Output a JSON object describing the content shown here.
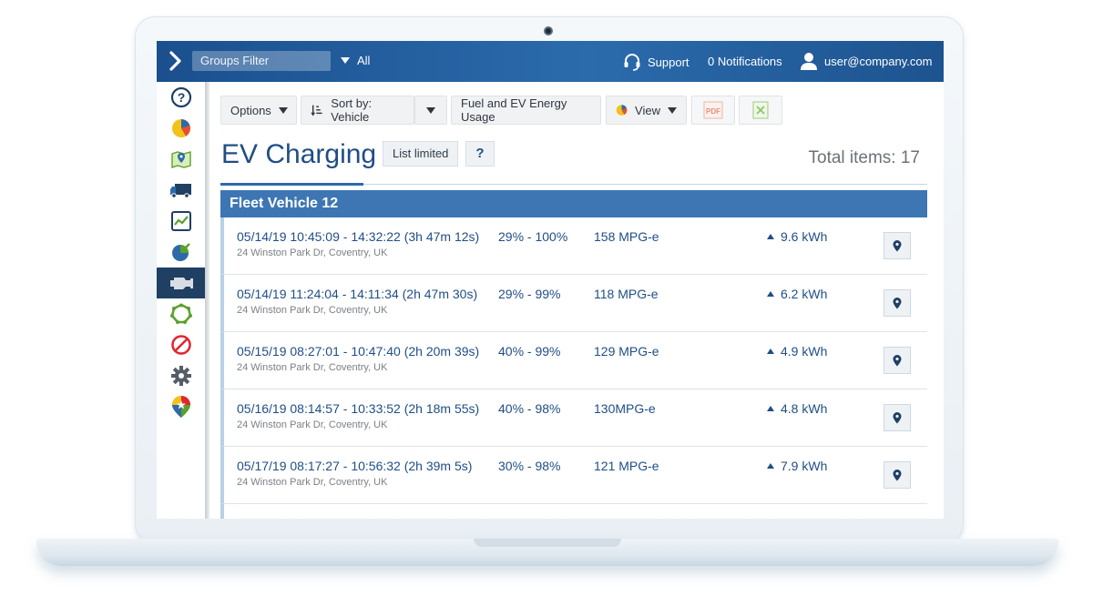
{
  "topbar": {
    "groups_filter_label": "Groups Filter",
    "filter_value": "All",
    "support_label": "Support",
    "notifications_label": "0 Notifications",
    "user_email": "user@company.com"
  },
  "sidebar": {
    "items": [
      {
        "icon": "help-icon"
      },
      {
        "icon": "pie-chart-icon"
      },
      {
        "icon": "map-icon"
      },
      {
        "icon": "truck-icon"
      },
      {
        "icon": "activity-chart-icon"
      },
      {
        "icon": "rules-icon"
      },
      {
        "icon": "engine-icon",
        "active": true
      },
      {
        "icon": "zones-icon"
      },
      {
        "icon": "exceptions-icon"
      },
      {
        "icon": "settings-gear-icon"
      },
      {
        "icon": "marketplace-icon"
      }
    ]
  },
  "toolbar": {
    "options_label": "Options",
    "sort_label": "Sort by: Vehicle",
    "report_label": "Fuel and EV Energy Usage",
    "view_label": "View",
    "pdf_label": "PDF"
  },
  "page": {
    "title": "EV Charging",
    "list_limited_label": "List limited",
    "help_label": "?",
    "total_items": "Total items: 17"
  },
  "group": {
    "name": "Fleet Vehicle 12",
    "rows": [
      {
        "time": "05/14/19 10:45:09 - 14:32:22 (3h 47m 12s)",
        "address": "24 Winston Park Dr, Coventry, UK",
        "soc": "29% - 100%",
        "mpg": "158 MPG-e",
        "energy": "9.6 kWh"
      },
      {
        "time": "05/14/19 11:24:04 - 14:11:34 (2h 47m 30s)",
        "address": "24 Winston Park Dr, Coventry, UK",
        "soc": "29% - 99%",
        "mpg": "118 MPG-e",
        "energy": "6.2 kWh"
      },
      {
        "time": "05/15/19 08:27:01 - 10:47:40 (2h 20m 39s)",
        "address": "24 Winston Park Dr, Coventry, UK",
        "soc": "40% - 99%",
        "mpg": "129 MPG-e",
        "energy": "4.9 kWh"
      },
      {
        "time": "05/16/19 08:14:57 - 10:33:52 (2h 18m 55s)",
        "address": "24 Winston Park Dr, Coventry, UK",
        "soc": "40% - 98%",
        "mpg": "130MPG-e",
        "energy": "4.8 kWh"
      },
      {
        "time": "05/17/19 08:17:27 - 10:56:32 (2h 39m 5s)",
        "address": "24 Winston Park Dr, Coventry, UK",
        "soc": "30% - 98%",
        "mpg": "121 MPG-e",
        "energy": "7.9 kWh"
      }
    ]
  },
  "colors": {
    "topbar_blue": "#1b4f8e",
    "group_header": "#3e76b3",
    "text_blue": "#1f4e86",
    "sidebar_active": "#1f3f63"
  }
}
